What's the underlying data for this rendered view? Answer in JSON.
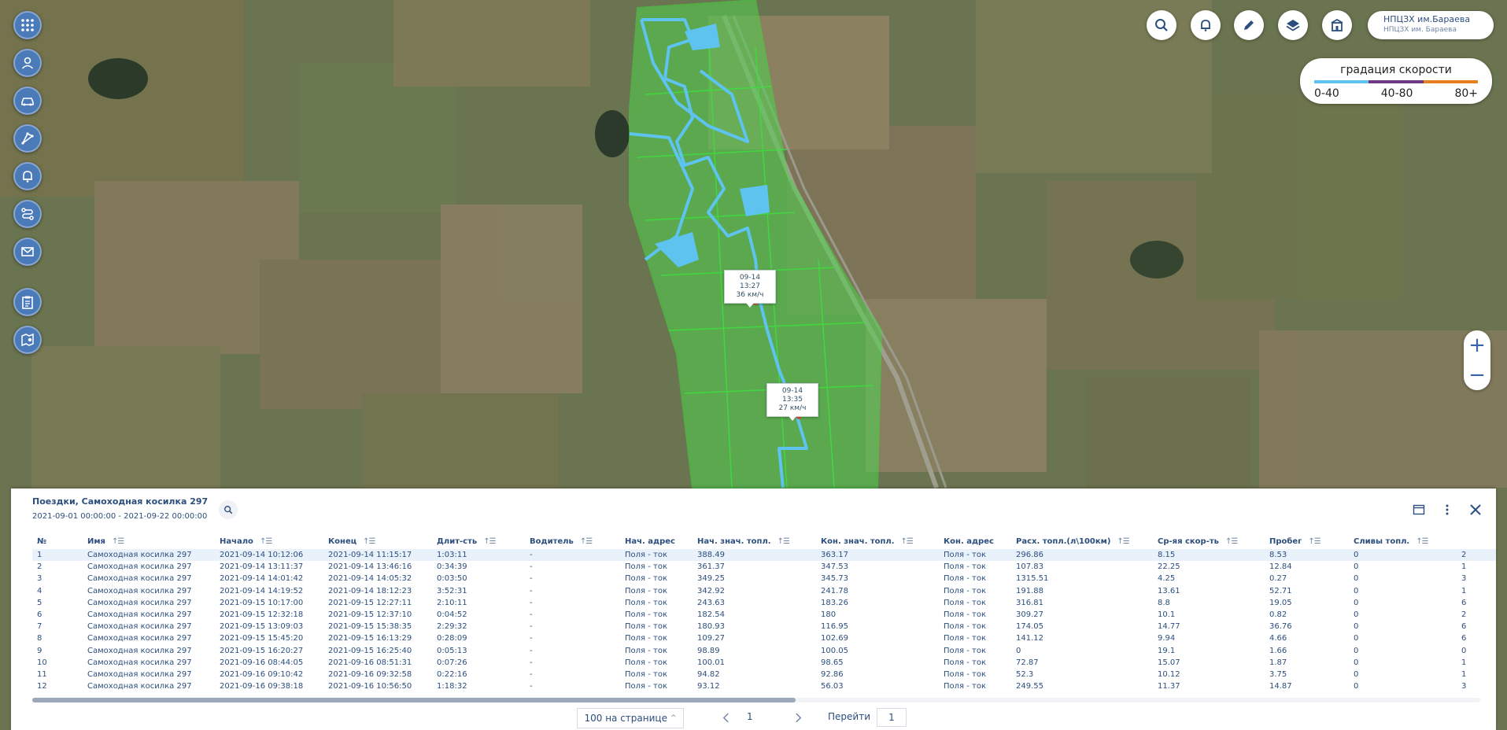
{
  "header": {
    "org_name": "НПЦЗХ им.Бараева",
    "org_sub": "НПЦЗХ им. Бараева"
  },
  "left_toolbar": [
    {
      "icon": "apps-grid-icon"
    },
    {
      "icon": "user-icon"
    },
    {
      "icon": "car-icon"
    },
    {
      "icon": "route-icon"
    },
    {
      "icon": "bell-icon"
    },
    {
      "icon": "trips-icon"
    },
    {
      "icon": "mail-icon"
    },
    {
      "icon": "clipboard-icon"
    },
    {
      "icon": "map-edit-icon"
    }
  ],
  "top_toolbar": [
    {
      "icon": "search-icon"
    },
    {
      "icon": "bell-icon"
    },
    {
      "icon": "pencil-icon"
    },
    {
      "icon": "layers-icon"
    },
    {
      "icon": "building-icon"
    }
  ],
  "legend": {
    "title": "градация скорости",
    "ranges": [
      {
        "label": "0-40",
        "color": "#5ec3ee"
      },
      {
        "label": "40-80",
        "color": "#6d3a86"
      },
      {
        "label": "80+",
        "color": "#e67e22"
      }
    ]
  },
  "zoom": {
    "in": "+",
    "out": "−"
  },
  "popups": [
    {
      "time": "09-14 13:27",
      "speed": "36 км/ч"
    },
    {
      "time": "09-14 13:35",
      "speed": "27 км/ч"
    }
  ],
  "panel": {
    "title": "Поездки, Самоходная косилка 297",
    "dates": "2021-09-01 00:00:00 - 2021-09-22 00:00:00",
    "columns": [
      "№",
      "Имя",
      "Начало",
      "Конец",
      "Длит-сть",
      "Водитель",
      "Нач. адрес",
      "Нач. знач. топл.",
      "Кон. знач. топл.",
      "Кон. адрес",
      "Расх. топл.(л\\100км)",
      "Ср-яя скор-ть",
      "Пробег",
      "Сливы топл."
    ],
    "rows": [
      [
        "1",
        "Самоходная косилка 297",
        "2021-09-14 10:12:06",
        "2021-09-14 11:15:17",
        "1:03:11",
        "-",
        "Поля - ток",
        "388.49",
        "363.17",
        "Поля - ток",
        "296.86",
        "8.15",
        "8.53",
        "0",
        "2"
      ],
      [
        "2",
        "Самоходная косилка 297",
        "2021-09-14 13:11:37",
        "2021-09-14 13:46:16",
        "0:34:39",
        "-",
        "Поля - ток",
        "361.37",
        "347.53",
        "Поля - ток",
        "107.83",
        "22.25",
        "12.84",
        "0",
        "1"
      ],
      [
        "3",
        "Самоходная косилка 297",
        "2021-09-14 14:01:42",
        "2021-09-14 14:05:32",
        "0:03:50",
        "-",
        "Поля - ток",
        "349.25",
        "345.73",
        "Поля - ток",
        "1315.51",
        "4.25",
        "0.27",
        "0",
        "3"
      ],
      [
        "4",
        "Самоходная косилка 297",
        "2021-09-14 14:19:52",
        "2021-09-14 18:12:23",
        "3:52:31",
        "-",
        "Поля - ток",
        "342.92",
        "241.78",
        "Поля - ток",
        "191.88",
        "13.61",
        "52.71",
        "0",
        "1"
      ],
      [
        "5",
        "Самоходная косилка 297",
        "2021-09-15 10:17:00",
        "2021-09-15 12:27:11",
        "2:10:11",
        "-",
        "Поля - ток",
        "243.63",
        "183.26",
        "Поля - ток",
        "316.81",
        "8.8",
        "19.05",
        "0",
        "6"
      ],
      [
        "6",
        "Самоходная косилка 297",
        "2021-09-15 12:32:18",
        "2021-09-15 12:37:10",
        "0:04:52",
        "-",
        "Поля - ток",
        "182.54",
        "180",
        "Поля - ток",
        "309.27",
        "10.1",
        "0.82",
        "0",
        "2"
      ],
      [
        "7",
        "Самоходная косилка 297",
        "2021-09-15 13:09:03",
        "2021-09-15 15:38:35",
        "2:29:32",
        "-",
        "Поля - ток",
        "180.93",
        "116.95",
        "Поля - ток",
        "174.05",
        "14.77",
        "36.76",
        "0",
        "6"
      ],
      [
        "8",
        "Самоходная косилка 297",
        "2021-09-15 15:45:20",
        "2021-09-15 16:13:29",
        "0:28:09",
        "-",
        "Поля - ток",
        "109.27",
        "102.69",
        "Поля - ток",
        "141.12",
        "9.94",
        "4.66",
        "0",
        "6"
      ],
      [
        "9",
        "Самоходная косилка 297",
        "2021-09-15 16:20:27",
        "2021-09-15 16:25:40",
        "0:05:13",
        "-",
        "Поля - ток",
        "98.89",
        "100.05",
        "Поля - ток",
        "0",
        "19.1",
        "1.66",
        "0",
        "0"
      ],
      [
        "10",
        "Самоходная косилка 297",
        "2021-09-16 08:44:05",
        "2021-09-16 08:51:31",
        "0:07:26",
        "-",
        "Поля - ток",
        "100.01",
        "98.65",
        "Поля - ток",
        "72.87",
        "15.07",
        "1.87",
        "0",
        "1"
      ],
      [
        "11",
        "Самоходная косилка 297",
        "2021-09-16 09:10:42",
        "2021-09-16 09:32:58",
        "0:22:16",
        "-",
        "Поля - ток",
        "94.82",
        "92.86",
        "Поля - ток",
        "52.3",
        "10.12",
        "3.75",
        "0",
        "1"
      ],
      [
        "12",
        "Самоходная косилка 297",
        "2021-09-16 09:38:18",
        "2021-09-16 10:56:50",
        "1:18:32",
        "-",
        "Поля - ток",
        "93.12",
        "56.03",
        "Поля - ток",
        "249.55",
        "11.37",
        "14.87",
        "0",
        "3"
      ]
    ],
    "sort_glyph": "↑☰",
    "pagination": {
      "per_page": "100 на странице",
      "page": "1",
      "goto_label": "Перейти",
      "goto_value": "1"
    }
  }
}
